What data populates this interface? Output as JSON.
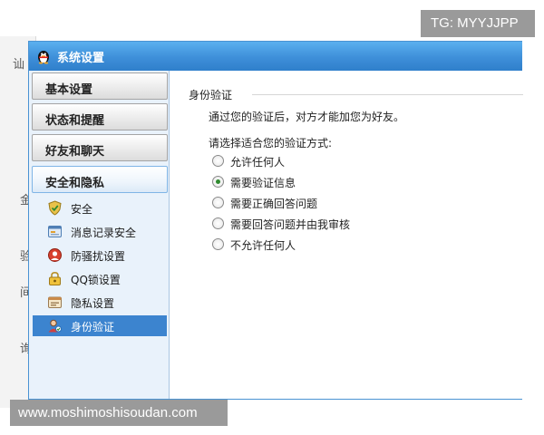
{
  "watermark_tg": "TG: MYYJJPP",
  "watermark_site": "www.moshimoshisoudan.com",
  "background_fragments": [
    "讪",
    "金",
    "验",
    "间",
    "询"
  ],
  "window": {
    "title": "系统设置",
    "icon": "qq-penguin-icon"
  },
  "sidebar": {
    "categories": [
      {
        "label": "基本设置"
      },
      {
        "label": "状态和提醒"
      },
      {
        "label": "好友和聊天"
      },
      {
        "label": "安全和隐私"
      }
    ],
    "sub_items": [
      {
        "label": "安全",
        "icon": "shield-icon"
      },
      {
        "label": "消息记录安全",
        "icon": "message-log-icon"
      },
      {
        "label": "防骚扰设置",
        "icon": "anti-harass-icon"
      },
      {
        "label": "QQ锁设置",
        "icon": "lock-icon"
      },
      {
        "label": "隐私设置",
        "icon": "privacy-icon"
      },
      {
        "label": "身份验证",
        "icon": "user-verify-icon",
        "selected": true
      }
    ]
  },
  "main": {
    "section_title": "身份验证",
    "description": "通过您的验证后，对方才能加您为好友。",
    "prompt": "请选择适合您的验证方式:",
    "options": [
      {
        "label": "允许任何人",
        "checked": false
      },
      {
        "label": "需要验证信息",
        "checked": true
      },
      {
        "label": "需要正确回答问题",
        "checked": false
      },
      {
        "label": "需要回答问题并由我审核",
        "checked": false
      },
      {
        "label": "不允许任何人",
        "checked": false
      }
    ]
  },
  "colors": {
    "titlebar": "#3e8fd9",
    "selected_item": "#3c84cf",
    "sidebar_bg": "#e9f2fb",
    "radio_dot": "#2f8a2f"
  }
}
